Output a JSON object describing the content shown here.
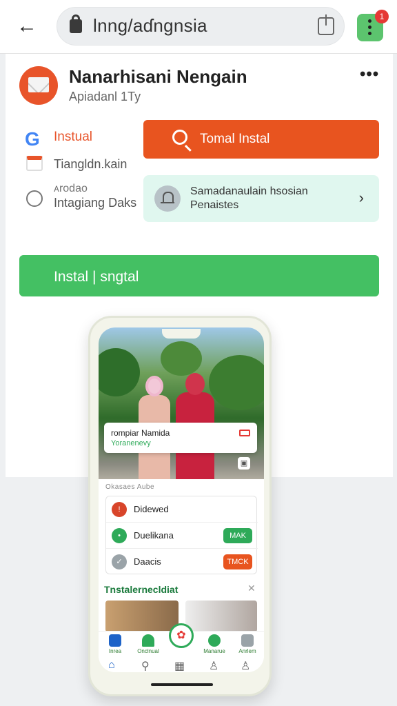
{
  "browser": {
    "url": "lnng/aɗngnsia",
    "badge_count": "1"
  },
  "profile": {
    "name": "Nanarhisani Nengain",
    "subtitle": "Apiadanl  1Ty"
  },
  "options": {
    "google_label": "Instual",
    "calendar_label": "Tiangldn.kain",
    "radio_label_small": "ᴀrodao",
    "radio_label": "Intagiang Daks"
  },
  "actions": {
    "orange_button": "Tomal Instal",
    "mint_card_line1": "Samadanaulain hsosian",
    "mint_card_line2": "Penaistes",
    "green_button": "Instal | sngtal"
  },
  "phone": {
    "photo_card_title": "rompiar Namida",
    "photo_card_sub": "Yoranenevy",
    "section_label": "Okasaes Aube",
    "rows": [
      {
        "label": "Didewed",
        "icon": "!",
        "color": "#d8452a",
        "button": ""
      },
      {
        "label": "Duelikana",
        "icon": "•",
        "color": "#2eaa59",
        "button": "MAK"
      },
      {
        "label": "Daacis",
        "icon": "✓",
        "color": "#9aa3a8",
        "button": "TMCK"
      }
    ],
    "row_button_colors": [
      "",
      "#2eaa59",
      "#e8541f"
    ],
    "install_heading": "Tnstalernecldiat",
    "tabs": [
      "Inrea",
      "Onclnual",
      "",
      "Manarue",
      "Anrlem"
    ]
  }
}
